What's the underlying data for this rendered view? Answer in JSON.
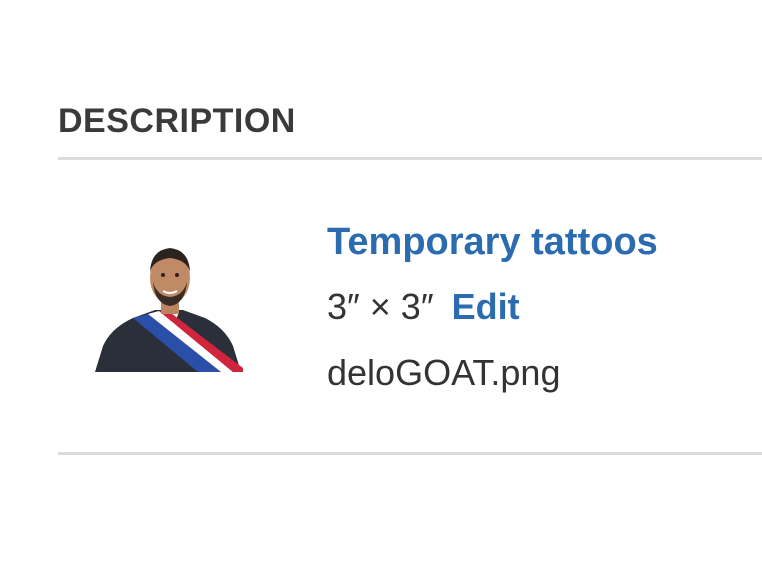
{
  "description": {
    "heading": "DESCRIPTION"
  },
  "item": {
    "product_name": "Temporary tattoos",
    "size": "3″ × 3″",
    "edit_label": "Edit",
    "filename": "deloGOAT.png",
    "thumbnail": "person-with-tricolor-sash-image"
  },
  "colors": {
    "link": "#2b6cb0",
    "text": "#333333",
    "divider": "#dcdcdc"
  }
}
